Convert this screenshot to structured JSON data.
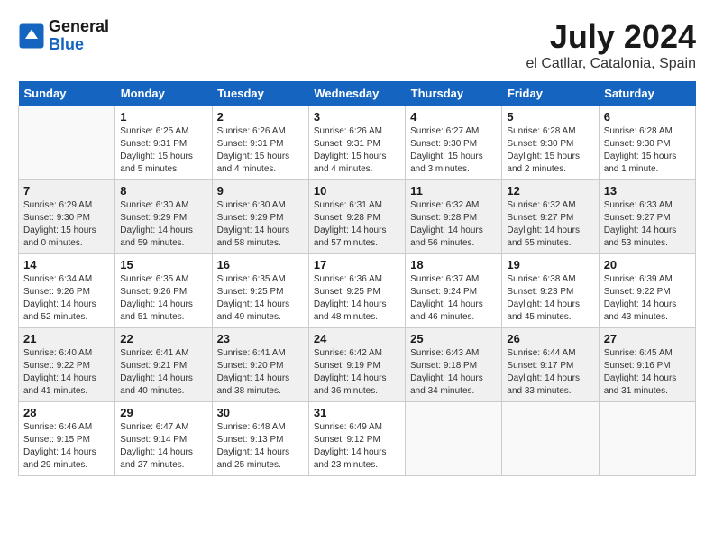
{
  "header": {
    "logo": {
      "general": "General",
      "blue": "Blue"
    },
    "month_year": "July 2024",
    "location": "el Catllar, Catalonia, Spain"
  },
  "weekdays": [
    "Sunday",
    "Monday",
    "Tuesday",
    "Wednesday",
    "Thursday",
    "Friday",
    "Saturday"
  ],
  "weeks": [
    [
      {
        "day": "",
        "info": ""
      },
      {
        "day": "1",
        "info": "Sunrise: 6:25 AM\nSunset: 9:31 PM\nDaylight: 15 hours\nand 5 minutes."
      },
      {
        "day": "2",
        "info": "Sunrise: 6:26 AM\nSunset: 9:31 PM\nDaylight: 15 hours\nand 4 minutes."
      },
      {
        "day": "3",
        "info": "Sunrise: 6:26 AM\nSunset: 9:31 PM\nDaylight: 15 hours\nand 4 minutes."
      },
      {
        "day": "4",
        "info": "Sunrise: 6:27 AM\nSunset: 9:30 PM\nDaylight: 15 hours\nand 3 minutes."
      },
      {
        "day": "5",
        "info": "Sunrise: 6:28 AM\nSunset: 9:30 PM\nDaylight: 15 hours\nand 2 minutes."
      },
      {
        "day": "6",
        "info": "Sunrise: 6:28 AM\nSunset: 9:30 PM\nDaylight: 15 hours\nand 1 minute."
      }
    ],
    [
      {
        "day": "7",
        "info": "Sunrise: 6:29 AM\nSunset: 9:30 PM\nDaylight: 15 hours\nand 0 minutes."
      },
      {
        "day": "8",
        "info": "Sunrise: 6:30 AM\nSunset: 9:29 PM\nDaylight: 14 hours\nand 59 minutes."
      },
      {
        "day": "9",
        "info": "Sunrise: 6:30 AM\nSunset: 9:29 PM\nDaylight: 14 hours\nand 58 minutes."
      },
      {
        "day": "10",
        "info": "Sunrise: 6:31 AM\nSunset: 9:28 PM\nDaylight: 14 hours\nand 57 minutes."
      },
      {
        "day": "11",
        "info": "Sunrise: 6:32 AM\nSunset: 9:28 PM\nDaylight: 14 hours\nand 56 minutes."
      },
      {
        "day": "12",
        "info": "Sunrise: 6:32 AM\nSunset: 9:27 PM\nDaylight: 14 hours\nand 55 minutes."
      },
      {
        "day": "13",
        "info": "Sunrise: 6:33 AM\nSunset: 9:27 PM\nDaylight: 14 hours\nand 53 minutes."
      }
    ],
    [
      {
        "day": "14",
        "info": "Sunrise: 6:34 AM\nSunset: 9:26 PM\nDaylight: 14 hours\nand 52 minutes."
      },
      {
        "day": "15",
        "info": "Sunrise: 6:35 AM\nSunset: 9:26 PM\nDaylight: 14 hours\nand 51 minutes."
      },
      {
        "day": "16",
        "info": "Sunrise: 6:35 AM\nSunset: 9:25 PM\nDaylight: 14 hours\nand 49 minutes."
      },
      {
        "day": "17",
        "info": "Sunrise: 6:36 AM\nSunset: 9:25 PM\nDaylight: 14 hours\nand 48 minutes."
      },
      {
        "day": "18",
        "info": "Sunrise: 6:37 AM\nSunset: 9:24 PM\nDaylight: 14 hours\nand 46 minutes."
      },
      {
        "day": "19",
        "info": "Sunrise: 6:38 AM\nSunset: 9:23 PM\nDaylight: 14 hours\nand 45 minutes."
      },
      {
        "day": "20",
        "info": "Sunrise: 6:39 AM\nSunset: 9:22 PM\nDaylight: 14 hours\nand 43 minutes."
      }
    ],
    [
      {
        "day": "21",
        "info": "Sunrise: 6:40 AM\nSunset: 9:22 PM\nDaylight: 14 hours\nand 41 minutes."
      },
      {
        "day": "22",
        "info": "Sunrise: 6:41 AM\nSunset: 9:21 PM\nDaylight: 14 hours\nand 40 minutes."
      },
      {
        "day": "23",
        "info": "Sunrise: 6:41 AM\nSunset: 9:20 PM\nDaylight: 14 hours\nand 38 minutes."
      },
      {
        "day": "24",
        "info": "Sunrise: 6:42 AM\nSunset: 9:19 PM\nDaylight: 14 hours\nand 36 minutes."
      },
      {
        "day": "25",
        "info": "Sunrise: 6:43 AM\nSunset: 9:18 PM\nDaylight: 14 hours\nand 34 minutes."
      },
      {
        "day": "26",
        "info": "Sunrise: 6:44 AM\nSunset: 9:17 PM\nDaylight: 14 hours\nand 33 minutes."
      },
      {
        "day": "27",
        "info": "Sunrise: 6:45 AM\nSunset: 9:16 PM\nDaylight: 14 hours\nand 31 minutes."
      }
    ],
    [
      {
        "day": "28",
        "info": "Sunrise: 6:46 AM\nSunset: 9:15 PM\nDaylight: 14 hours\nand 29 minutes."
      },
      {
        "day": "29",
        "info": "Sunrise: 6:47 AM\nSunset: 9:14 PM\nDaylight: 14 hours\nand 27 minutes."
      },
      {
        "day": "30",
        "info": "Sunrise: 6:48 AM\nSunset: 9:13 PM\nDaylight: 14 hours\nand 25 minutes."
      },
      {
        "day": "31",
        "info": "Sunrise: 6:49 AM\nSunset: 9:12 PM\nDaylight: 14 hours\nand 23 minutes."
      },
      {
        "day": "",
        "info": ""
      },
      {
        "day": "",
        "info": ""
      },
      {
        "day": "",
        "info": ""
      }
    ]
  ]
}
